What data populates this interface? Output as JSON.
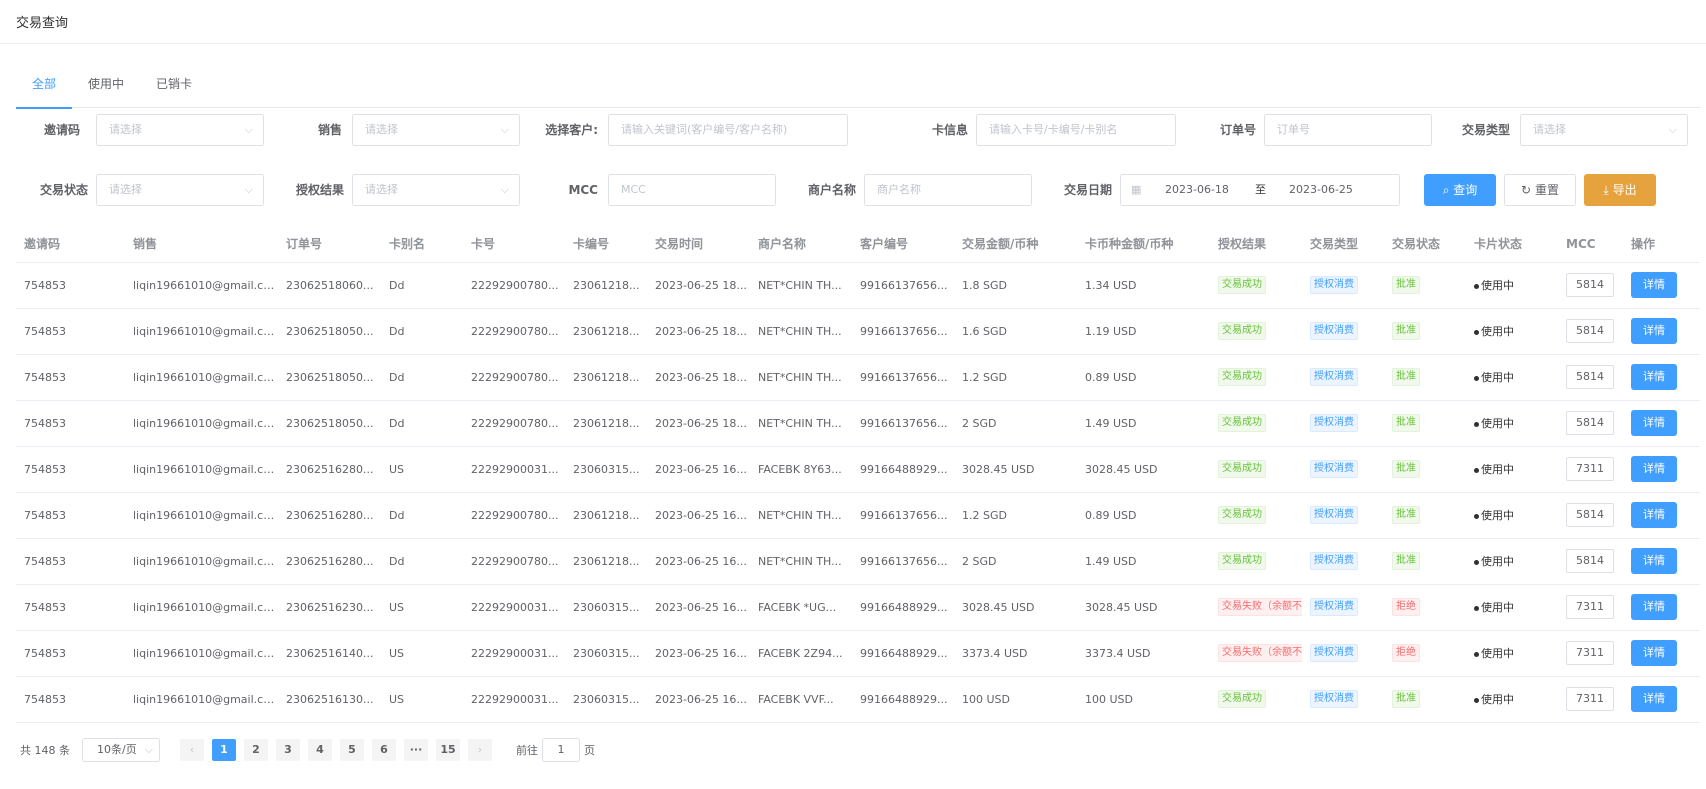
{
  "page_title": "交易查询",
  "tabs": [
    {
      "label": "全部",
      "active": true
    },
    {
      "label": "使用中",
      "active": false
    },
    {
      "label": "已销卡",
      "active": false
    }
  ],
  "filters": {
    "invite_code": {
      "label": "邀请码",
      "placeholder": "请选择"
    },
    "sales": {
      "label": "销售",
      "placeholder": "请选择"
    },
    "customer": {
      "label": "选择客户:",
      "placeholder": "请输入关键词(客户编号/客户名称)"
    },
    "card_info": {
      "label": "卡信息",
      "placeholder": "请输入卡号/卡编号/卡别名"
    },
    "order_no": {
      "label": "订单号",
      "placeholder": "订单号"
    },
    "trade_type": {
      "label": "交易类型",
      "placeholder": "请选择"
    },
    "trade_status": {
      "label": "交易状态",
      "placeholder": "请选择"
    },
    "auth_result": {
      "label": "授权结果",
      "placeholder": "请选择"
    },
    "mcc": {
      "label": "MCC",
      "placeholder": "MCC"
    },
    "merchant": {
      "label": "商户名称",
      "placeholder": "商户名称"
    },
    "date": {
      "label": "交易日期",
      "start": "2023-06-18",
      "separator": "至",
      "end": "2023-06-25"
    }
  },
  "buttons": {
    "search": "查询",
    "reset": "重置",
    "export": "导出"
  },
  "table": {
    "columns": [
      "邀请码",
      "销售",
      "订单号",
      "卡别名",
      "卡号",
      "卡编号",
      "交易时间",
      "商户名称",
      "客户编号",
      "交易金额/币种",
      "卡币种金额/币种",
      "授权结果",
      "交易类型",
      "交易状态",
      "卡片状态",
      "MCC",
      "操作"
    ],
    "rows": [
      {
        "invite": "754853",
        "sales": "liqin19661010@gmail.com",
        "order": "23062518060...",
        "alias": "Dd",
        "card_no": "22292900780...",
        "card_id": "23061218...",
        "time": "2023-06-25 18...",
        "merchant": "NET*CHIN TH...",
        "customer": "99166137656...",
        "amount": "1.8 SGD",
        "card_amount": "1.34 USD",
        "auth": "交易成功",
        "auth_ok": true,
        "type": "授权消费",
        "status": "批准",
        "status_ok": true,
        "card_status": "使用中",
        "mcc": "5814",
        "action": "详情"
      },
      {
        "invite": "754853",
        "sales": "liqin19661010@gmail.com",
        "order": "23062518050...",
        "alias": "Dd",
        "card_no": "22292900780...",
        "card_id": "23061218...",
        "time": "2023-06-25 18...",
        "merchant": "NET*CHIN TH...",
        "customer": "99166137656...",
        "amount": "1.6 SGD",
        "card_amount": "1.19 USD",
        "auth": "交易成功",
        "auth_ok": true,
        "type": "授权消费",
        "status": "批准",
        "status_ok": true,
        "card_status": "使用中",
        "mcc": "5814",
        "action": "详情"
      },
      {
        "invite": "754853",
        "sales": "liqin19661010@gmail.com",
        "order": "23062518050...",
        "alias": "Dd",
        "card_no": "22292900780...",
        "card_id": "23061218...",
        "time": "2023-06-25 18...",
        "merchant": "NET*CHIN TH...",
        "customer": "99166137656...",
        "amount": "1.2 SGD",
        "card_amount": "0.89 USD",
        "auth": "交易成功",
        "auth_ok": true,
        "type": "授权消费",
        "status": "批准",
        "status_ok": true,
        "card_status": "使用中",
        "mcc": "5814",
        "action": "详情"
      },
      {
        "invite": "754853",
        "sales": "liqin19661010@gmail.com",
        "order": "23062518050...",
        "alias": "Dd",
        "card_no": "22292900780...",
        "card_id": "23061218...",
        "time": "2023-06-25 18...",
        "merchant": "NET*CHIN TH...",
        "customer": "99166137656...",
        "amount": "2 SGD",
        "card_amount": "1.49 USD",
        "auth": "交易成功",
        "auth_ok": true,
        "type": "授权消费",
        "status": "批准",
        "status_ok": true,
        "card_status": "使用中",
        "mcc": "5814",
        "action": "详情"
      },
      {
        "invite": "754853",
        "sales": "liqin19661010@gmail.com",
        "order": "23062516280...",
        "alias": "US",
        "card_no": "22292900031...",
        "card_id": "23060315...",
        "time": "2023-06-25 16...",
        "merchant": "FACEBK 8Y63...",
        "customer": "99166488929...",
        "amount": "3028.45 USD",
        "card_amount": "3028.45 USD",
        "auth": "交易成功",
        "auth_ok": true,
        "type": "授权消费",
        "status": "批准",
        "status_ok": true,
        "card_status": "使用中",
        "mcc": "7311",
        "action": "详情"
      },
      {
        "invite": "754853",
        "sales": "liqin19661010@gmail.com",
        "order": "23062516280...",
        "alias": "Dd",
        "card_no": "22292900780...",
        "card_id": "23061218...",
        "time": "2023-06-25 16...",
        "merchant": "NET*CHIN TH...",
        "customer": "99166137656...",
        "amount": "1.2 SGD",
        "card_amount": "0.89 USD",
        "auth": "交易成功",
        "auth_ok": true,
        "type": "授权消费",
        "status": "批准",
        "status_ok": true,
        "card_status": "使用中",
        "mcc": "5814",
        "action": "详情"
      },
      {
        "invite": "754853",
        "sales": "liqin19661010@gmail.com",
        "order": "23062516280...",
        "alias": "Dd",
        "card_no": "22292900780...",
        "card_id": "23061218...",
        "time": "2023-06-25 16...",
        "merchant": "NET*CHIN TH...",
        "customer": "99166137656...",
        "amount": "2 SGD",
        "card_amount": "1.49 USD",
        "auth": "交易成功",
        "auth_ok": true,
        "type": "授权消费",
        "status": "批准",
        "status_ok": true,
        "card_status": "使用中",
        "mcc": "5814",
        "action": "详情"
      },
      {
        "invite": "754853",
        "sales": "liqin19661010@gmail.com",
        "order": "23062516230...",
        "alias": "US",
        "card_no": "22292900031...",
        "card_id": "23060315...",
        "time": "2023-06-25 16...",
        "merchant": "FACEBK *UG...",
        "customer": "99166488929...",
        "amount": "3028.45 USD",
        "card_amount": "3028.45 USD",
        "auth": "交易失败（余额不",
        "auth_ok": false,
        "type": "授权消费",
        "status": "拒绝",
        "status_ok": false,
        "card_status": "使用中",
        "mcc": "7311",
        "action": "详情"
      },
      {
        "invite": "754853",
        "sales": "liqin19661010@gmail.com",
        "order": "23062516140...",
        "alias": "US",
        "card_no": "22292900031...",
        "card_id": "23060315...",
        "time": "2023-06-25 16...",
        "merchant": "FACEBK 2Z94...",
        "customer": "99166488929...",
        "amount": "3373.4 USD",
        "card_amount": "3373.4 USD",
        "auth": "交易失败（余额不",
        "auth_ok": false,
        "type": "授权消费",
        "status": "拒绝",
        "status_ok": false,
        "card_status": "使用中",
        "mcc": "7311",
        "action": "详情"
      },
      {
        "invite": "754853",
        "sales": "liqin19661010@gmail.com",
        "order": "23062516130...",
        "alias": "US",
        "card_no": "22292900031...",
        "card_id": "23060315...",
        "time": "2023-06-25 16...",
        "merchant": "FACEBK VVF...",
        "customer": "99166488929...",
        "amount": "100 USD",
        "card_amount": "100 USD",
        "auth": "交易成功",
        "auth_ok": true,
        "type": "授权消费",
        "status": "批准",
        "status_ok": true,
        "card_status": "使用中",
        "mcc": "7311",
        "action": "详情"
      }
    ]
  },
  "pagination": {
    "total_text": "共 148 条",
    "page_size": "10条/页",
    "prev": "‹",
    "next": "›",
    "pages": [
      "1",
      "2",
      "3",
      "4",
      "5",
      "6",
      "···",
      "15"
    ],
    "current": "1",
    "jump_label": "前往",
    "jump_value": "1",
    "jump_suffix": "页"
  },
  "icons": {
    "chevron": "⌵",
    "calendar": "▦",
    "search": "⌕",
    "reset": "↻",
    "export": "⤓"
  },
  "colors": {
    "primary": "#409eff",
    "warning": "#e6a23c",
    "success": "#67c23a",
    "danger": "#f56c6c"
  }
}
